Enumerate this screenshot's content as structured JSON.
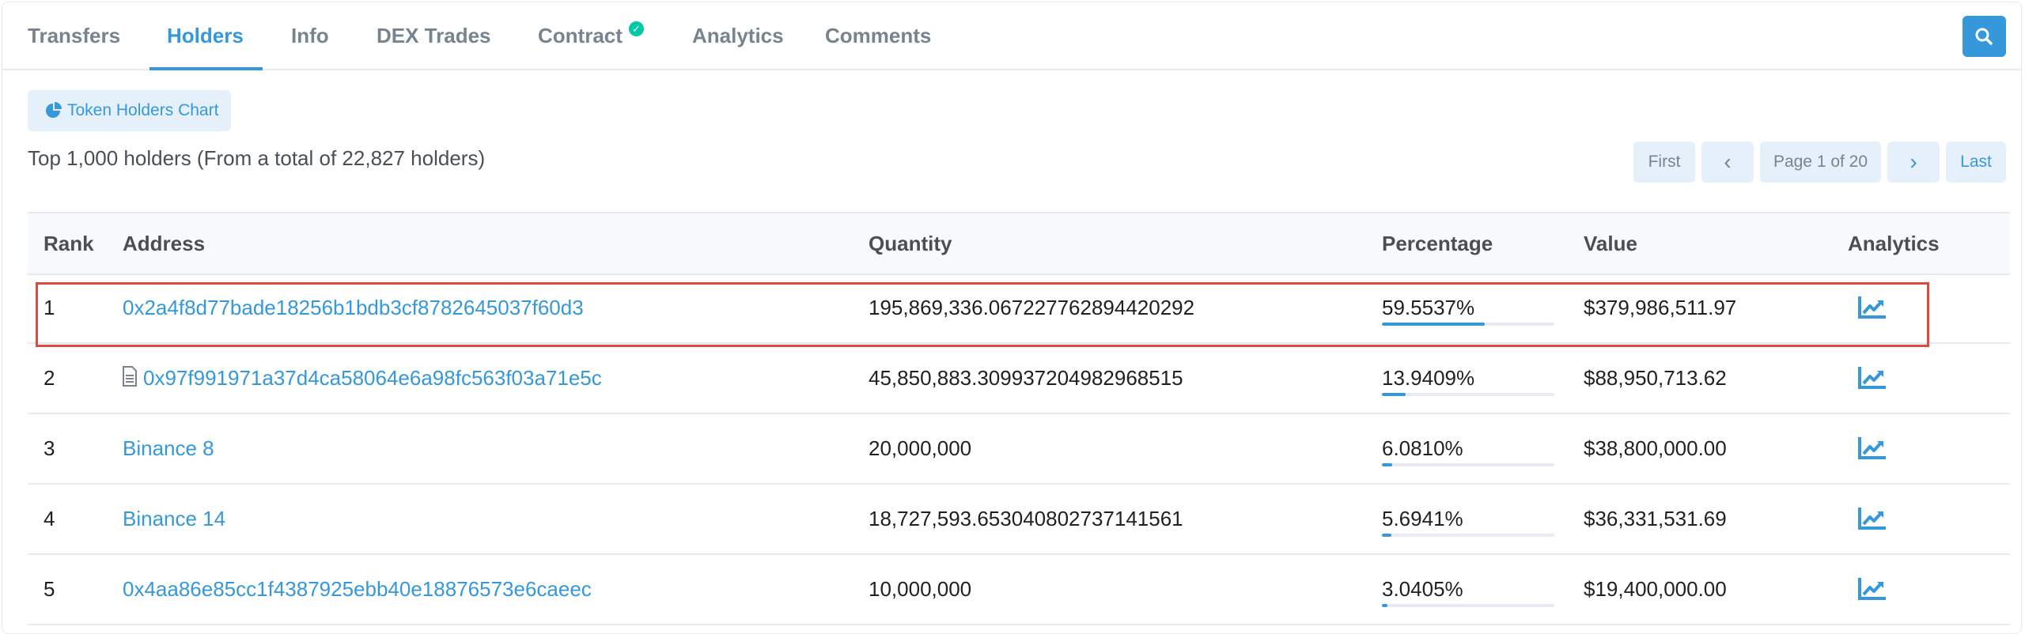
{
  "tabs": [
    {
      "label": "Transfers"
    },
    {
      "label": "Holders"
    },
    {
      "label": "Info"
    },
    {
      "label": "DEX Trades"
    },
    {
      "label": "Contract"
    },
    {
      "label": "Analytics"
    },
    {
      "label": "Comments"
    }
  ],
  "active_tab": "Holders",
  "chart_button": {
    "label": "Token Holders Chart"
  },
  "summary": "Top 1,000 holders (From a total of 22,827 holders)",
  "pagination": {
    "first": "First",
    "prev": "‹",
    "page_label": "Page 1 of 20",
    "next": "›",
    "last": "Last"
  },
  "table": {
    "headers": {
      "rank": "Rank",
      "address": "Address",
      "quantity": "Quantity",
      "percentage": "Percentage",
      "value": "Value",
      "analytics": "Analytics"
    },
    "rows": [
      {
        "rank": "1",
        "address": "0x2a4f8d77bade18256b1bdb3cf8782645037f60d3",
        "is_contract": false,
        "quantity": "195,869,336.067227762894420292",
        "percentage": "59.5537%",
        "pct_value": 59.5537,
        "value": "$379,986,511.97"
      },
      {
        "rank": "2",
        "address": "0x97f991971a37d4ca58064e6a98fc563f03a71e5c",
        "is_contract": true,
        "quantity": "45,850,883.309937204982968515",
        "percentage": "13.9409%",
        "pct_value": 13.9409,
        "value": "$88,950,713.62"
      },
      {
        "rank": "3",
        "address": "Binance 8",
        "is_contract": false,
        "quantity": "20,000,000",
        "percentage": "6.0810%",
        "pct_value": 6.081,
        "value": "$38,800,000.00"
      },
      {
        "rank": "4",
        "address": "Binance 14",
        "is_contract": false,
        "quantity": "18,727,593.653040802737141561",
        "percentage": "5.6941%",
        "pct_value": 5.6941,
        "value": "$36,331,531.69"
      },
      {
        "rank": "5",
        "address": "0x4aa86e85cc1f4387925ebb40e18876573e6caeec",
        "is_contract": false,
        "quantity": "10,000,000",
        "percentage": "3.0405%",
        "pct_value": 3.0405,
        "value": "$19,400,000.00"
      }
    ]
  },
  "colors": {
    "accent": "#3498db",
    "verified": "#00c9a7",
    "highlight": "#e2483d"
  },
  "icons": {
    "search": "search-icon",
    "verified": "check-circle-icon",
    "chart": "pie-chart-icon",
    "contract": "document-icon",
    "analytics": "line-chart-icon"
  }
}
